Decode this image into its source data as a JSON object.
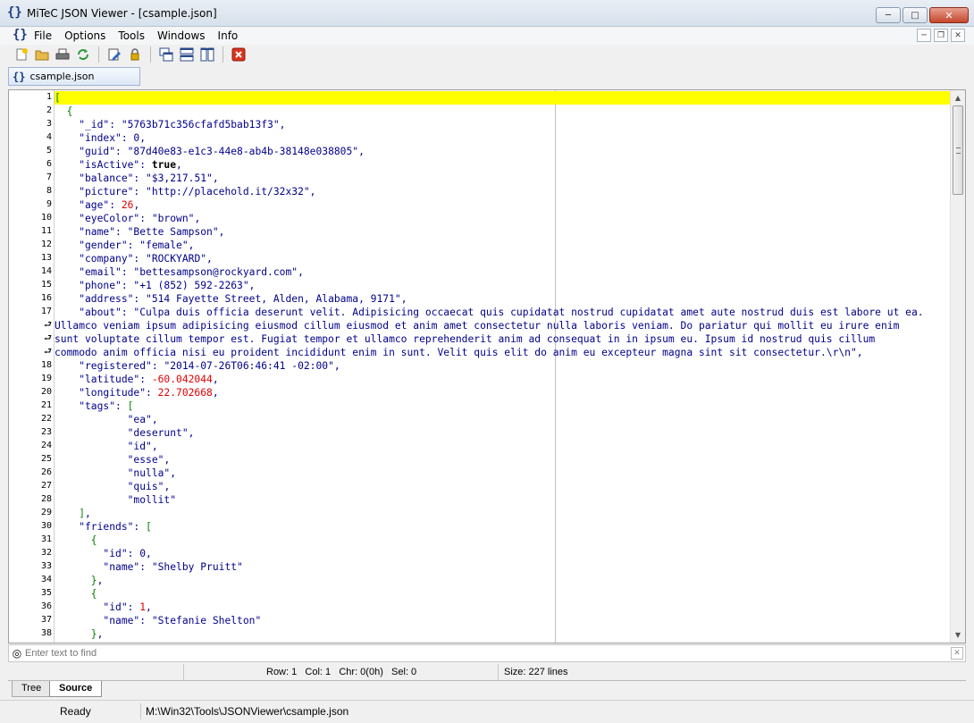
{
  "window": {
    "title": "MiTeC JSON Viewer - [csample.json]",
    "app_glyph": "{}"
  },
  "menu": {
    "items": [
      "File",
      "Options",
      "Tools",
      "Windows",
      "Info"
    ]
  },
  "toolbar": {
    "tools": [
      "new-icon",
      "open-icon",
      "print-icon",
      "refresh-icon",
      "edit-icon",
      "lock-icon",
      "cascade-icon",
      "tile-horizontal-icon",
      "tile-vertical-icon",
      "close-doc-icon"
    ]
  },
  "doc_tab": {
    "label": "csample.json"
  },
  "editor": {
    "gutter": [
      "1",
      "2",
      "3",
      "4",
      "5",
      "6",
      "7",
      "8",
      "9",
      "10",
      "11",
      "12",
      "13",
      "14",
      "15",
      "16",
      "17",
      "⮐",
      "⮐",
      "⮐",
      "18",
      "19",
      "20",
      "21",
      "22",
      "23",
      "24",
      "25",
      "26",
      "27",
      "28",
      "29",
      "30",
      "31",
      "32",
      "33",
      "34",
      "35",
      "36",
      "37",
      "38"
    ],
    "lines": [
      [
        {
          "t": "[",
          "c": "p"
        }
      ],
      [
        {
          "t": "  {",
          "c": "p"
        }
      ],
      [
        {
          "t": "    \"_id\": ",
          "c": "k"
        },
        {
          "t": "\"5763b71c356cfafd5bab13f3\"",
          "c": "s"
        },
        {
          "t": ",",
          "c": "k"
        }
      ],
      [
        {
          "t": "    \"index\": ",
          "c": "k"
        },
        {
          "t": "0",
          "c": "k"
        },
        {
          "t": ",",
          "c": "k"
        }
      ],
      [
        {
          "t": "    \"guid\": ",
          "c": "k"
        },
        {
          "t": "\"87d40e83-e1c3-44e8-ab4b-38148e038805\"",
          "c": "s"
        },
        {
          "t": ",",
          "c": "k"
        }
      ],
      [
        {
          "t": "    \"isActive\": ",
          "c": "k"
        },
        {
          "t": "true",
          "c": "b"
        },
        {
          "t": ",",
          "c": "k"
        }
      ],
      [
        {
          "t": "    \"balance\": ",
          "c": "k"
        },
        {
          "t": "\"$3,217.51\"",
          "c": "s"
        },
        {
          "t": ",",
          "c": "k"
        }
      ],
      [
        {
          "t": "    \"picture\": ",
          "c": "k"
        },
        {
          "t": "\"http://placehold.it/32x32\"",
          "c": "s"
        },
        {
          "t": ",",
          "c": "k"
        }
      ],
      [
        {
          "t": "    \"age\": ",
          "c": "k"
        },
        {
          "t": "26",
          "c": "n"
        },
        {
          "t": ",",
          "c": "k"
        }
      ],
      [
        {
          "t": "    \"eyeColor\": ",
          "c": "k"
        },
        {
          "t": "\"brown\"",
          "c": "s"
        },
        {
          "t": ",",
          "c": "k"
        }
      ],
      [
        {
          "t": "    \"name\": ",
          "c": "k"
        },
        {
          "t": "\"Bette Sampson\"",
          "c": "s"
        },
        {
          "t": ",",
          "c": "k"
        }
      ],
      [
        {
          "t": "    \"gender\": ",
          "c": "k"
        },
        {
          "t": "\"female\"",
          "c": "s"
        },
        {
          "t": ",",
          "c": "k"
        }
      ],
      [
        {
          "t": "    \"company\": ",
          "c": "k"
        },
        {
          "t": "\"ROCKYARD\"",
          "c": "s"
        },
        {
          "t": ",",
          "c": "k"
        }
      ],
      [
        {
          "t": "    \"email\": ",
          "c": "k"
        },
        {
          "t": "\"bettesampson@rockyard.com\"",
          "c": "s"
        },
        {
          "t": ",",
          "c": "k"
        }
      ],
      [
        {
          "t": "    \"phone\": ",
          "c": "k"
        },
        {
          "t": "\"+1 (852) 592-2263\"",
          "c": "s"
        },
        {
          "t": ",",
          "c": "k"
        }
      ],
      [
        {
          "t": "    \"address\": ",
          "c": "k"
        },
        {
          "t": "\"514 Fayette Street, Alden, Alabama, 9171\"",
          "c": "s"
        },
        {
          "t": ",",
          "c": "k"
        }
      ],
      [
        {
          "t": "    \"about\": ",
          "c": "k"
        },
        {
          "t": "\"Culpa duis officia deserunt velit. Adipisicing occaecat quis cupidatat nostrud cupidatat amet aute nostrud duis est labore ut ea.",
          "c": "s"
        }
      ],
      [
        {
          "t": "Ullamco veniam ipsum adipisicing eiusmod cillum eiusmod et anim amet consectetur nulla laboris veniam. Do pariatur qui mollit eu irure enim",
          "c": "s"
        }
      ],
      [
        {
          "t": "sunt voluptate cillum tempor est. Fugiat tempor et ullamco reprehenderit anim ad consequat in in ipsum eu. Ipsum id nostrud quis cillum",
          "c": "s"
        }
      ],
      [
        {
          "t": "commodo anim officia nisi eu proident incididunt enim in sunt. Velit quis elit do anim eu excepteur magna sint sit consectetur.\\r\\n\"",
          "c": "s"
        },
        {
          "t": ",",
          "c": "k"
        }
      ],
      [
        {
          "t": "    \"registered\": ",
          "c": "k"
        },
        {
          "t": "\"2014-07-26T06:46:41 -02:00\"",
          "c": "s"
        },
        {
          "t": ",",
          "c": "k"
        }
      ],
      [
        {
          "t": "    \"latitude\": ",
          "c": "k"
        },
        {
          "t": "-60.042044",
          "c": "n"
        },
        {
          "t": ",",
          "c": "k"
        }
      ],
      [
        {
          "t": "    \"longitude\": ",
          "c": "k"
        },
        {
          "t": "22.702668",
          "c": "n"
        },
        {
          "t": ",",
          "c": "k"
        }
      ],
      [
        {
          "t": "    \"tags\": ",
          "c": "k"
        },
        {
          "t": "[",
          "c": "p"
        }
      ],
      [
        {
          "t": "            \"ea\"",
          "c": "s"
        },
        {
          "t": ",",
          "c": "k"
        }
      ],
      [
        {
          "t": "            \"deserunt\"",
          "c": "s"
        },
        {
          "t": ",",
          "c": "k"
        }
      ],
      [
        {
          "t": "            \"id\"",
          "c": "s"
        },
        {
          "t": ",",
          "c": "k"
        }
      ],
      [
        {
          "t": "            \"esse\"",
          "c": "s"
        },
        {
          "t": ",",
          "c": "k"
        }
      ],
      [
        {
          "t": "            \"nulla\"",
          "c": "s"
        },
        {
          "t": ",",
          "c": "k"
        }
      ],
      [
        {
          "t": "            \"quis\"",
          "c": "s"
        },
        {
          "t": ",",
          "c": "k"
        }
      ],
      [
        {
          "t": "            \"mollit\"",
          "c": "s"
        }
      ],
      [
        {
          "t": "    ]",
          "c": "p"
        },
        {
          "t": ",",
          "c": "k"
        }
      ],
      [
        {
          "t": "    \"friends\": ",
          "c": "k"
        },
        {
          "t": "[",
          "c": "p"
        }
      ],
      [
        {
          "t": "      {",
          "c": "p"
        }
      ],
      [
        {
          "t": "        \"id\": ",
          "c": "k"
        },
        {
          "t": "0",
          "c": "k"
        },
        {
          "t": ",",
          "c": "k"
        }
      ],
      [
        {
          "t": "        \"name\": ",
          "c": "k"
        },
        {
          "t": "\"Shelby Pruitt\"",
          "c": "s"
        }
      ],
      [
        {
          "t": "      }",
          "c": "p"
        },
        {
          "t": ",",
          "c": "k"
        }
      ],
      [
        {
          "t": "      {",
          "c": "p"
        }
      ],
      [
        {
          "t": "        \"id\": ",
          "c": "k"
        },
        {
          "t": "1",
          "c": "n"
        },
        {
          "t": ",",
          "c": "k"
        }
      ],
      [
        {
          "t": "        \"name\": ",
          "c": "k"
        },
        {
          "t": "\"Stefanie Shelton\"",
          "c": "s"
        }
      ],
      [
        {
          "t": "      }",
          "c": "p"
        },
        {
          "t": ",",
          "c": "k"
        }
      ]
    ]
  },
  "find": {
    "placeholder": "Enter text to find"
  },
  "editor_status": {
    "row": "Row: 1",
    "col": "Col: 1",
    "chr": "Chr: 0(0h)",
    "sel": "Sel: 0",
    "size": "Size: 227 lines"
  },
  "view_tabs": {
    "tree": "Tree",
    "source": "Source"
  },
  "statusbar": {
    "state": "Ready",
    "path": "M:\\Win32\\Tools\\JSONViewer\\csample.json"
  },
  "colors": {
    "highlight": "#ffff00",
    "string": "#00008b",
    "number": "#e00000",
    "punct": "#008000"
  }
}
